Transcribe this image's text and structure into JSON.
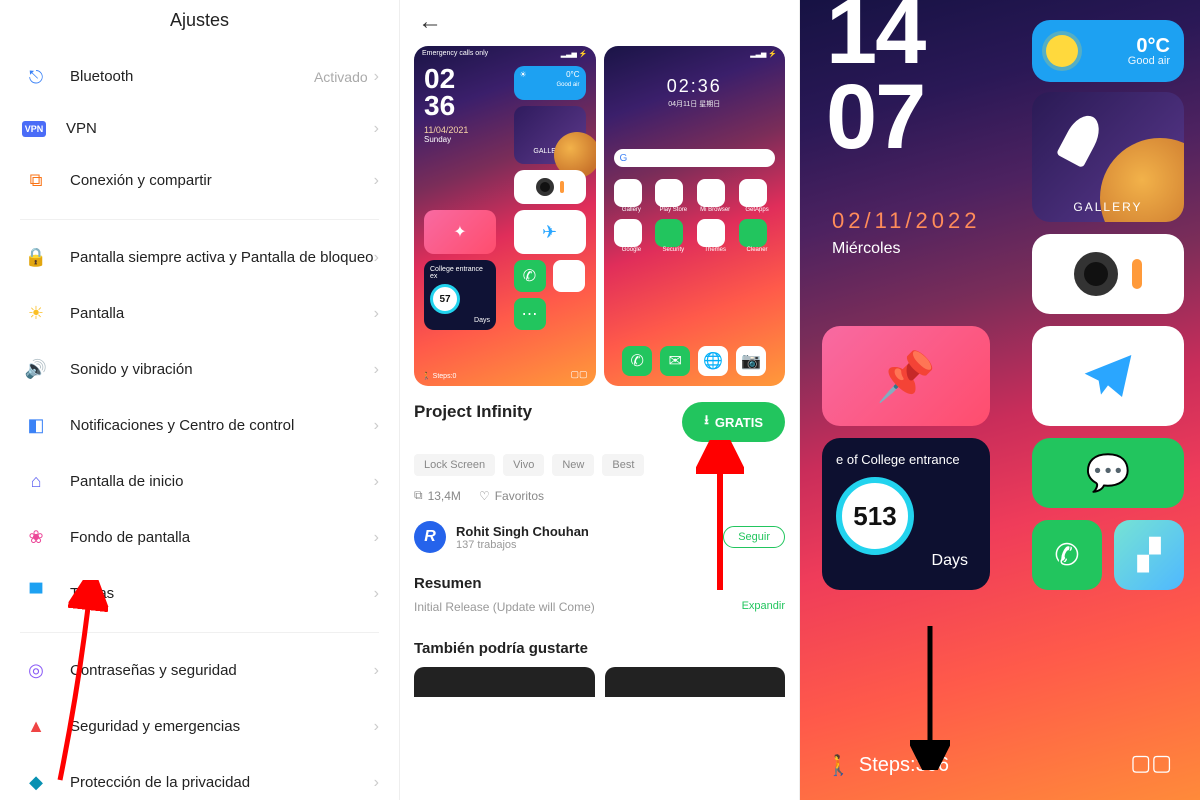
{
  "panel1": {
    "title": "Ajustes",
    "items": [
      {
        "icon": "bt",
        "iconClass": "i-bt",
        "glyph": "⎋",
        "label": "Bluetooth",
        "value": "Activado"
      },
      {
        "icon": "vpn",
        "iconClass": "i-vpn",
        "glyph": "VPN",
        "label": "VPN",
        "value": ""
      },
      {
        "icon": "share",
        "iconClass": "i-share",
        "glyph": "⧉",
        "label": "Conexión y compartir",
        "value": ""
      }
    ],
    "items2": [
      {
        "icon": "lock",
        "iconClass": "i-lock",
        "glyph": "🔒",
        "label": "Pantalla siempre activa y Pantalla de bloqueo"
      },
      {
        "icon": "sun",
        "iconClass": "i-sun",
        "glyph": "☀",
        "label": "Pantalla"
      },
      {
        "icon": "sound",
        "iconClass": "i-sound",
        "glyph": "🔊",
        "label": "Sonido y vibración"
      },
      {
        "icon": "notif",
        "iconClass": "i-notif",
        "glyph": "◧",
        "label": "Notificaciones y Centro de control"
      },
      {
        "icon": "home",
        "iconClass": "i-home",
        "glyph": "⌂",
        "label": "Pantalla de inicio"
      },
      {
        "icon": "wall",
        "iconClass": "i-wall",
        "glyph": "❀",
        "label": "Fondo de pantalla"
      },
      {
        "icon": "theme",
        "iconClass": "i-theme",
        "glyph": "▀",
        "label": "Temas"
      }
    ],
    "items3": [
      {
        "icon": "pass",
        "iconClass": "i-pass",
        "glyph": "◎",
        "label": "Contraseñas y seguridad"
      },
      {
        "icon": "alert",
        "iconClass": "i-alert",
        "glyph": "▲",
        "label": "Seguridad y emergencias"
      },
      {
        "icon": "priv",
        "iconClass": "i-priv",
        "glyph": "◆",
        "label": "Protección de la privacidad"
      }
    ]
  },
  "panel2": {
    "statusbar": "Emergency calls only",
    "preview1": {
      "clock_a": "02",
      "clock_b": "36",
      "date": "11/04/2021",
      "day": "Sunday",
      "gallery": "GALLERY",
      "weather_temp": "0°C",
      "weather_txt": "Good air",
      "college": "College entrance ex",
      "ring": "57",
      "ring_unit": "Days",
      "steps": "Steps:0"
    },
    "preview2": {
      "time": "02:36",
      "date": "04月11日  星期日",
      "apps": [
        "Gallery",
        "Play Store",
        "Mi Browser",
        "GetApps",
        "Google",
        "Security",
        "Themes",
        "Cleaner"
      ]
    },
    "theme_name": "Project Infinity",
    "download_label": "GRATIS",
    "tags": [
      "Lock Screen",
      "Vivo",
      "New",
      "Best"
    ],
    "size": "13,4M",
    "fav": "Favoritos",
    "author": "Rohit Singh Chouhan",
    "author_works": "137 trabajos",
    "follow": "Seguir",
    "summary_title": "Resumen",
    "summary_text": "Initial Release (Update will Come)",
    "expand": "Expandir",
    "also_like": "También podría gustarte"
  },
  "panel3": {
    "clock_a": "14",
    "clock_b": "07",
    "weather_temp": "0°C",
    "weather_txt": "Good air",
    "gallery": "GALLERY",
    "date": "02/11/2022",
    "day": "Miércoles",
    "college": "e of College entrance",
    "ring": "513",
    "ring_unit": "Days",
    "steps_label": "Steps:",
    "steps_val": "396"
  }
}
